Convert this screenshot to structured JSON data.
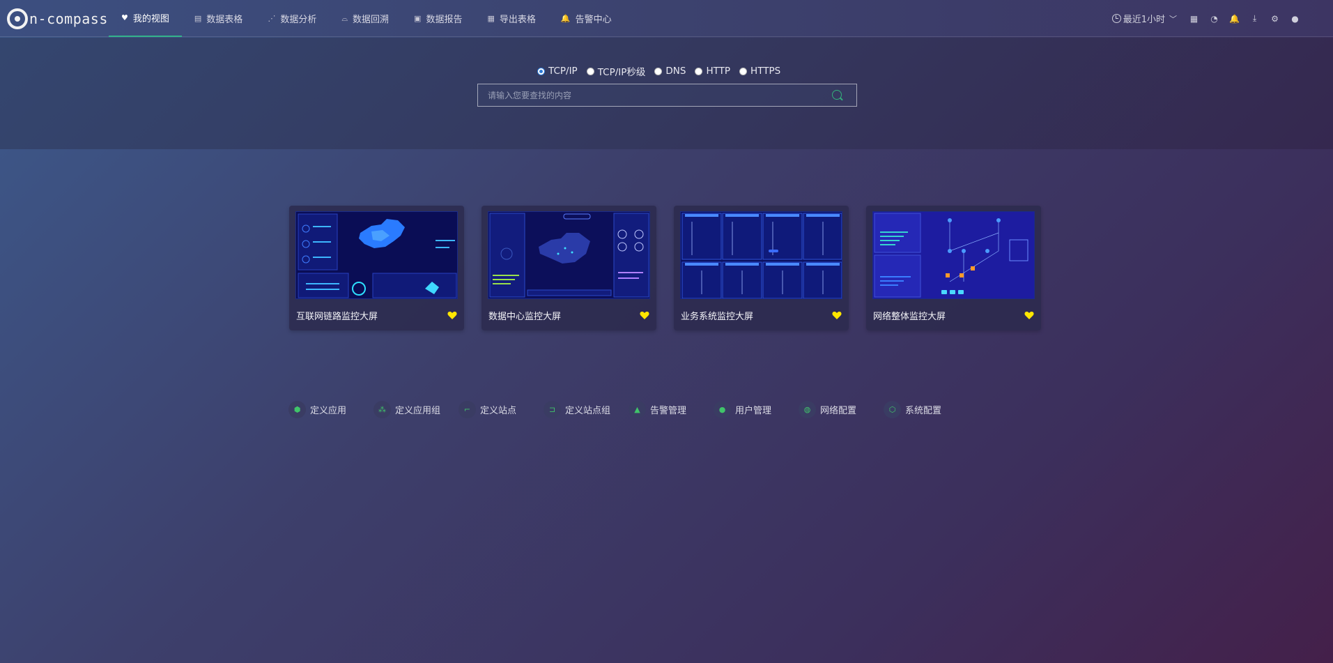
{
  "brand": {
    "logo_text": "n-compass"
  },
  "nav": {
    "items": [
      {
        "icon": "heart-icon",
        "glyph": "♥",
        "label": "我的视图"
      },
      {
        "icon": "table-icon",
        "glyph": "▤",
        "label": "数据表格"
      },
      {
        "icon": "analysis-icon",
        "glyph": "⋰",
        "label": "数据分析"
      },
      {
        "icon": "replay-icon",
        "glyph": "⌓",
        "label": "数据回溯"
      },
      {
        "icon": "report-icon",
        "glyph": "▣",
        "label": "数据报告"
      },
      {
        "icon": "export-icon",
        "glyph": "▦",
        "label": "导出表格"
      },
      {
        "icon": "bell-icon",
        "glyph": "🔔",
        "label": "告警中心"
      }
    ]
  },
  "tools": {
    "time_range": "最近1小时",
    "icons": [
      {
        "name": "grid-icon",
        "glyph": "▦"
      },
      {
        "name": "dashboard-icon",
        "glyph": "◔"
      },
      {
        "name": "notification-icon",
        "glyph": "🔔"
      },
      {
        "name": "download-icon",
        "glyph": "⤓"
      },
      {
        "name": "settings-icon",
        "glyph": "⚙"
      },
      {
        "name": "logout-icon",
        "glyph": "●"
      }
    ]
  },
  "search": {
    "protocols": [
      "TCP/IP",
      "TCP/IP秒级",
      "DNS",
      "HTTP",
      "HTTPS"
    ],
    "selected": "TCP/IP",
    "placeholder": "请输入您要查找的内容",
    "value": ""
  },
  "cards": [
    {
      "title": "互联网链路监控大屏",
      "favorite": true
    },
    {
      "title": "数据中心监控大屏",
      "favorite": true
    },
    {
      "title": "业务系统监控大屏",
      "favorite": true
    },
    {
      "title": "网络整体监控大屏",
      "favorite": true
    }
  ],
  "quick_links": [
    {
      "icon": "cube-icon",
      "glyph": "⬢",
      "label": "定义应用"
    },
    {
      "icon": "app-group-icon",
      "glyph": "⁂",
      "label": "定义应用组"
    },
    {
      "icon": "site-icon",
      "glyph": "⌐",
      "label": "定义站点"
    },
    {
      "icon": "site-group-icon",
      "glyph": "⊐",
      "label": "定义站点组"
    },
    {
      "icon": "warning-icon",
      "glyph": "▲",
      "label": "告警管理"
    },
    {
      "icon": "users-icon",
      "glyph": "●",
      "label": "用户管理"
    },
    {
      "icon": "globe-icon",
      "glyph": "◍",
      "label": "网络配置"
    },
    {
      "icon": "gear-icon",
      "glyph": "⬡",
      "label": "系统配置"
    }
  ],
  "colors": {
    "accent": "#34b38a",
    "heart": "#ffe600",
    "radio_selected": "#2d7ad6"
  }
}
